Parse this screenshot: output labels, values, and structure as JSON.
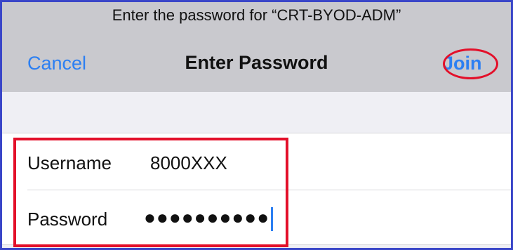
{
  "dialog": {
    "prompt": "Enter the password for “CRT-BYOD-ADM”",
    "title": "Enter Password",
    "cancel_label": "Cancel",
    "join_label": "Join"
  },
  "form": {
    "username": {
      "label": "Username",
      "value": "8000XXX"
    },
    "password": {
      "label": "Password",
      "masked_value": "●●●●●●●●●●"
    }
  },
  "colors": {
    "accent": "#2c7ff2",
    "highlight": "#e3102a",
    "frame": "#3a46c8",
    "header_bg": "#c9c9ce"
  }
}
